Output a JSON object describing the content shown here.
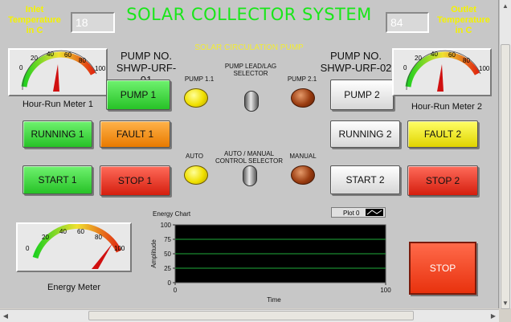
{
  "title": "SOLAR COLLECTOR SYSTEM",
  "subtitle": "SOLAR CIRCULATION PUMP",
  "inlet": {
    "label": "Inlet Temperature in C",
    "value": "18"
  },
  "outlet": {
    "label": "Outlet Temperature in C",
    "value": "84"
  },
  "pump1": {
    "name": "PUMP NO. SHWP-URF-01",
    "pump_label": "PUMP 1",
    "running_label": "RUNNING 1",
    "fault_label": "FAULT 1",
    "start_label": "START 1",
    "stop_label": "STOP 1",
    "meter_label": "Hour-Run Meter 1",
    "meter_value": 42
  },
  "pump2": {
    "name": "PUMP NO. SHWP-URF-02",
    "pump_label": "PUMP 2",
    "running_label": "RUNNING 2",
    "fault_label": "FAULT 2",
    "start_label": "START 2",
    "stop_label": "STOP 2",
    "meter_label": "Hour-Run Meter 2",
    "meter_value": 42
  },
  "center": {
    "pump11": "PUMP 1.1",
    "leadlag": "PUMP LEAD/LAG SELECTOR",
    "pump21": "PUMP 2.1",
    "auto": "AUTO",
    "automanual": "AUTO / MANUAL CONTROL SELECTOR",
    "manual": "MANUAL"
  },
  "meter_ticks": [
    "0",
    "20",
    "40",
    "60",
    "80",
    "100"
  ],
  "energy_meter": {
    "label": "Energy Meter",
    "value": 84
  },
  "chart_data": {
    "type": "line",
    "title": "Energy Chart",
    "xlabel": "Time",
    "ylabel": "Amplitude",
    "legend": "Plot 0",
    "xlim": [
      0,
      100
    ],
    "ylim": [
      0,
      100
    ],
    "xticks": [
      "0",
      "100"
    ],
    "yticks": [
      "100",
      "75",
      "50",
      "25",
      "0"
    ],
    "series": [
      {
        "name": "Plot 0",
        "values": []
      }
    ],
    "grid": true
  },
  "stop_button": "STOP",
  "colors": {
    "title": "#19e619",
    "label_yellow": "#f4f200",
    "plot_bg": "#000000",
    "grid": "#1faa3a"
  }
}
